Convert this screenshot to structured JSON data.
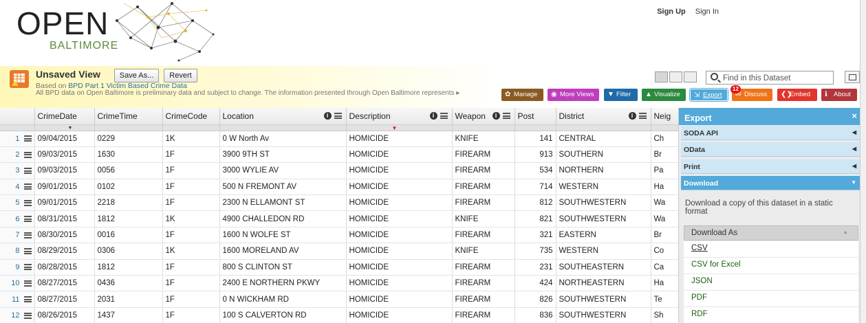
{
  "header": {
    "logo_open": "OPEN",
    "logo_city": "BALTIMORE",
    "sign_up": "Sign Up",
    "sign_in": "Sign In"
  },
  "view": {
    "title": "Unsaved View",
    "save_as": "Save As...",
    "revert": "Revert",
    "based_on_prefix": "Based on",
    "based_on_link": "BPD Part 1 Victim Based Crime Data",
    "disclaimer": "All BPD data on Open Baltimore is preliminary data and subject to change. The information presented through Open Baltimore represents"
  },
  "search": {
    "placeholder": "Find in this Dataset"
  },
  "actions": [
    {
      "label": "Manage",
      "color": "#8a5a22",
      "icon": "gear-icon"
    },
    {
      "label": "More Views",
      "color": "#c03dbd",
      "icon": "views-icon"
    },
    {
      "label": "Filter",
      "color": "#1f6aa8",
      "icon": "filter-icon"
    },
    {
      "label": "Visualize",
      "color": "#2a8a3e",
      "icon": "chart-icon"
    },
    {
      "label": "Export",
      "color": "#53a9d9",
      "icon": "export-icon"
    },
    {
      "label": "Discuss",
      "color": "#f07318",
      "icon": "discuss-icon"
    },
    {
      "label": "Embed",
      "color": "#e0352b",
      "icon": "embed-icon"
    },
    {
      "label": "About",
      "color": "#b2353d",
      "icon": "info-icon"
    }
  ],
  "discuss_badge": "12",
  "grid": {
    "columns": [
      "CrimeDate",
      "CrimeTime",
      "CrimeCode",
      "Location",
      "Description",
      "Weapon",
      "Post",
      "District",
      "Neig"
    ],
    "rows": [
      [
        "1",
        "09/04/2015",
        "0229",
        "1K",
        "0 W North Av",
        "HOMICIDE",
        "KNIFE",
        "141",
        "CENTRAL",
        "Ch"
      ],
      [
        "2",
        "09/03/2015",
        "1630",
        "1F",
        "3900 9TH ST",
        "HOMICIDE",
        "FIREARM",
        "913",
        "SOUTHERN",
        "Br"
      ],
      [
        "3",
        "09/03/2015",
        "0056",
        "1F",
        "3000 WYLIE AV",
        "HOMICIDE",
        "FIREARM",
        "534",
        "NORTHERN",
        "Pa"
      ],
      [
        "4",
        "09/01/2015",
        "0102",
        "1F",
        "500 N FREMONT AV",
        "HOMICIDE",
        "FIREARM",
        "714",
        "WESTERN",
        "Ha"
      ],
      [
        "5",
        "09/01/2015",
        "2218",
        "1F",
        "2300 N ELLAMONT ST",
        "HOMICIDE",
        "FIREARM",
        "812",
        "SOUTHWESTERN",
        "Wa"
      ],
      [
        "6",
        "08/31/2015",
        "1812",
        "1K",
        "4900 CHALLEDON RD",
        "HOMICIDE",
        "KNIFE",
        "821",
        "SOUTHWESTERN",
        "Wa"
      ],
      [
        "7",
        "08/30/2015",
        "0016",
        "1F",
        "1600 N WOLFE ST",
        "HOMICIDE",
        "FIREARM",
        "321",
        "EASTERN",
        "Br"
      ],
      [
        "8",
        "08/29/2015",
        "0306",
        "1K",
        "1600 MORELAND AV",
        "HOMICIDE",
        "KNIFE",
        "735",
        "WESTERN",
        "Co"
      ],
      [
        "9",
        "08/28/2015",
        "1812",
        "1F",
        "800 S CLINTON ST",
        "HOMICIDE",
        "FIREARM",
        "231",
        "SOUTHEASTERN",
        "Ca"
      ],
      [
        "10",
        "08/27/2015",
        "0436",
        "1F",
        "2400 E NORTHERN PKWY",
        "HOMICIDE",
        "FIREARM",
        "424",
        "NORTHEASTERN",
        "Ha"
      ],
      [
        "11",
        "08/27/2015",
        "2031",
        "1F",
        "0 N WICKHAM RD",
        "HOMICIDE",
        "FIREARM",
        "826",
        "SOUTHWESTERN",
        "Te"
      ],
      [
        "12",
        "08/26/2015",
        "1437",
        "1F",
        "100 S CALVERTON RD",
        "HOMICIDE",
        "FIREARM",
        "836",
        "SOUTHWESTERN",
        "Sh"
      ]
    ]
  },
  "export": {
    "title": "Export",
    "close": "×",
    "sections": [
      "SODA API",
      "OData",
      "Print",
      "Download"
    ],
    "download_desc": "Download a copy of this dataset in a static format",
    "download_as": "Download As",
    "options": [
      "CSV",
      "CSV for Excel",
      "JSON",
      "PDF",
      "RDF"
    ]
  }
}
